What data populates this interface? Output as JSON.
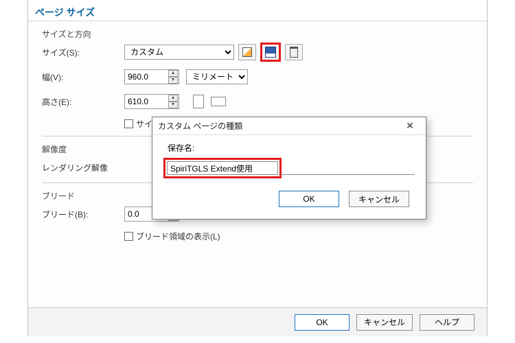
{
  "title": "ページ サイズ",
  "section_size": "サイズと方向",
  "labels": {
    "size": "サイズ(S):",
    "width": "幅(V):",
    "height": "高さ(E):",
    "resolution": "解像度",
    "rendering": "レンダリング解像",
    "bleed_section": "ブリード",
    "bleed": "ブリード(B):"
  },
  "fields": {
    "size_value": "カスタム",
    "width_value": "960.0",
    "height_value": "610.0",
    "unit_value": "ミリメートル",
    "bleed_value": "0.0"
  },
  "checkboxes": {
    "apply_current": "サイズを現在のページにのみ適用(O)",
    "show_bleed": "ブリード領域の表示(L)"
  },
  "buttons": {
    "ok": "OK",
    "cancel": "キャンセル",
    "help": "ヘルプ"
  },
  "dialog": {
    "title": "カスタム ページの種類",
    "save_label": "保存名:",
    "save_value": "SpiriTGLS Extend使用",
    "ok": "OK",
    "cancel": "キャンセル"
  }
}
